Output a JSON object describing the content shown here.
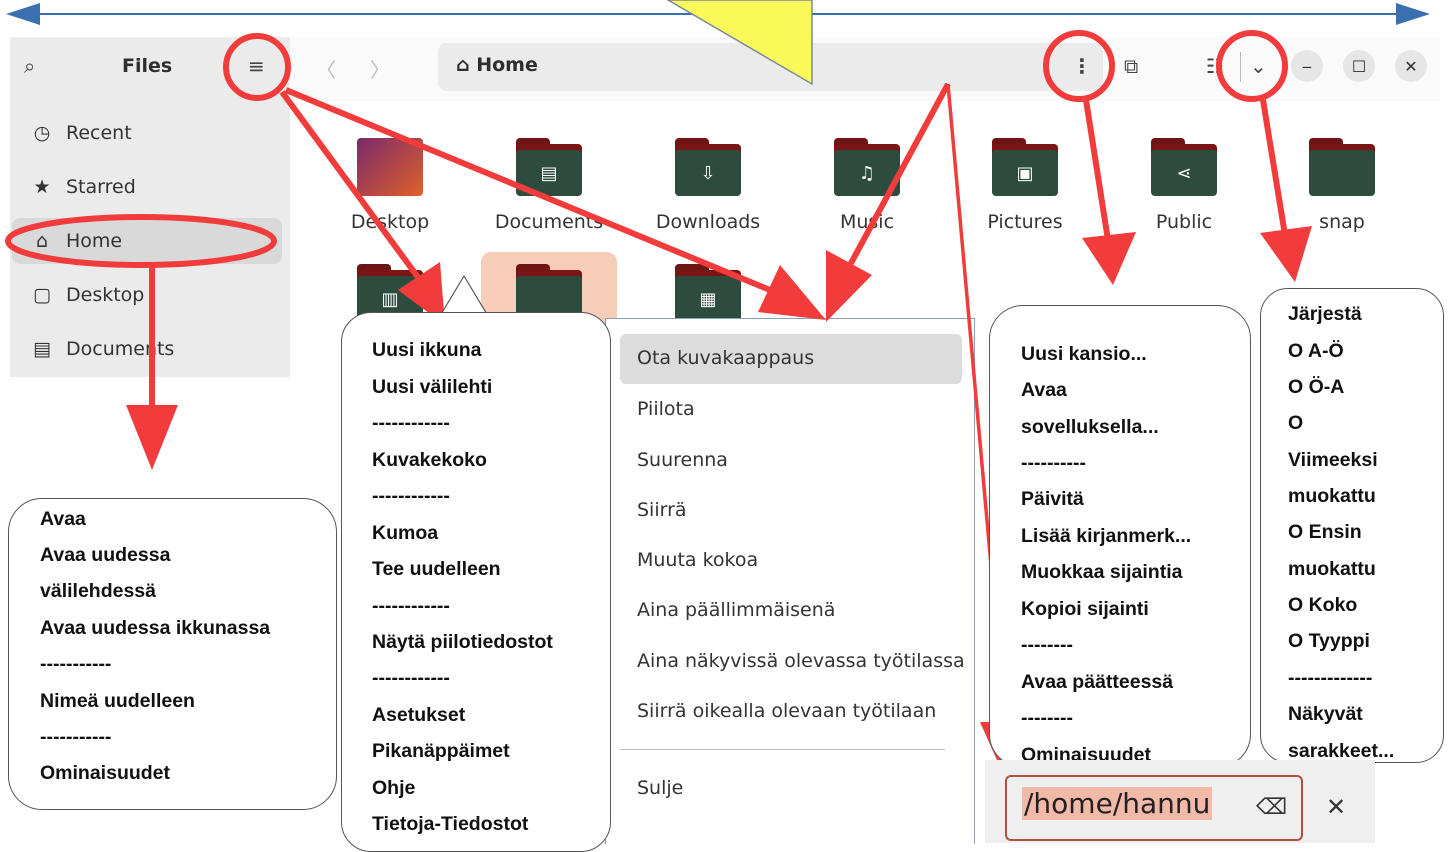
{
  "window": {
    "title": "Files",
    "sidebar": [
      {
        "icon": "clock-icon",
        "glyph": "◷",
        "label": "Recent"
      },
      {
        "icon": "star-icon",
        "glyph": "★",
        "label": "Starred"
      },
      {
        "icon": "home-icon",
        "glyph": "⌂",
        "label": "Home"
      },
      {
        "icon": "desktop-icon",
        "glyph": "▢",
        "label": "Desktop"
      },
      {
        "icon": "document-icon",
        "glyph": "▤",
        "label": "Documents"
      }
    ],
    "path": "Home",
    "folders_row1": [
      "Desktop",
      "Documents",
      "Downloads",
      "Music",
      "Pictures",
      "Public",
      "snap"
    ]
  },
  "menus": {
    "file_context": {
      "items": [
        "Avaa",
        "Avaa uudessa",
        "välilehdessä",
        "Avaa uudessa ikkunassa",
        "-----------",
        "Nimeä uudelleen",
        "-----------",
        "Ominaisuudet"
      ]
    },
    "main_menu": {
      "items": [
        "Uusi ikkuna",
        "Uusi välilehti",
        "------------",
        "Kuvakekoko",
        "------------",
        "Kumoa",
        "Tee uudelleen",
        "------------",
        "Näytä piilotiedostot",
        "------------",
        "Asetukset",
        "Pikanäppäimet",
        "Ohje",
        "Tietoja-Tiedostot"
      ]
    },
    "window_menu": {
      "items": [
        "Ota kuvakaappaus",
        "Piilota",
        "Suurenna",
        "Siirrä",
        "Muuta kokoa",
        "Aina päällimmäisenä",
        "Aina näkyvissä olevassa työtilassa",
        "Siirrä oikealla olevaan työtilaan"
      ],
      "close": "Sulje"
    },
    "folder_menu": {
      "items": [
        "Uusi kansio...",
        "Avaa",
        "sovelluksella...",
        "----------",
        "Päivitä",
        "Lisää kirjanmerk...",
        "Muokkaa sijaintia",
        "Kopioi sijainti",
        "--------",
        "Avaa päätteessä",
        "--------",
        "Ominaisuudet"
      ]
    },
    "sort_menu": {
      "items": [
        "Järjestä",
        "O  A-Ö",
        "O Ö-A",
        "O",
        "Viimeeksi",
        "muokattu",
        "O Ensin",
        "muokattu",
        "O Koko",
        "O Tyyppi",
        "-------------",
        "Näkyvät",
        "sarakkeet..."
      ]
    }
  },
  "location_entry": {
    "value": "/home/hannu"
  },
  "colors": {
    "annotation_red": "#f23c3c",
    "arrow_blue": "#3a6fb0",
    "triangle_yellow": "#fbf95a"
  }
}
